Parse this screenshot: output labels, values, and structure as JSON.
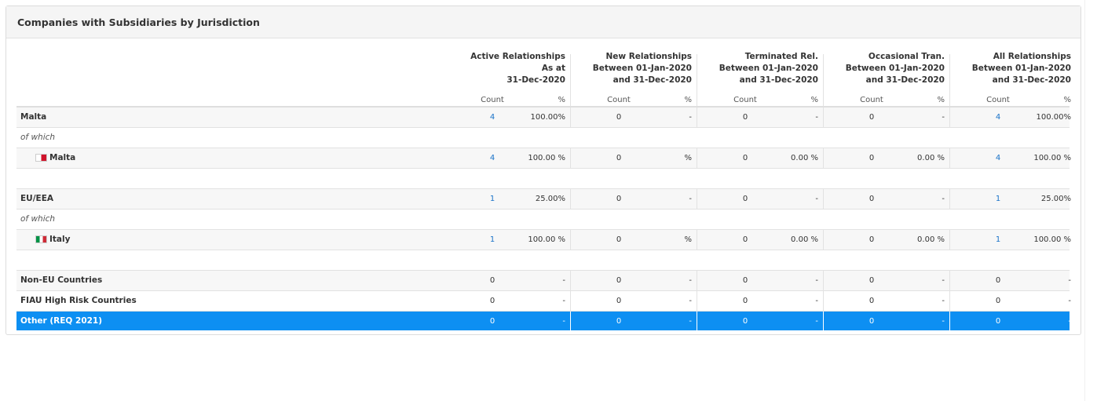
{
  "panel": {
    "title": "Companies with Subsidiaries by Jurisdiction"
  },
  "columns": [
    {
      "title_lines": [
        "Active Relationships",
        "As at",
        "31-Dec-2020"
      ],
      "count_label": "Count",
      "pct_label": "%"
    },
    {
      "title_lines": [
        "New Relationships",
        "Between 01-Jan-2020",
        "and 31-Dec-2020"
      ],
      "count_label": "Count",
      "pct_label": "%"
    },
    {
      "title_lines": [
        "Terminated Rel.",
        "Between 01-Jan-2020",
        "and 31-Dec-2020"
      ],
      "count_label": "Count",
      "pct_label": "%"
    },
    {
      "title_lines": [
        "Occasional Tran.",
        "Between 01-Jan-2020",
        "and 31-Dec-2020"
      ],
      "count_label": "Count",
      "pct_label": "%"
    },
    {
      "title_lines": [
        "All Relationships",
        "Between 01-Jan-2020",
        "and 31-Dec-2020"
      ],
      "count_label": "Count",
      "pct_label": "%"
    }
  ],
  "rows": [
    {
      "kind": "group",
      "label": "Malta",
      "cells": [
        [
          "4",
          "100.00%"
        ],
        [
          "0",
          "-"
        ],
        [
          "0",
          "-"
        ],
        [
          "0",
          "-"
        ],
        [
          "4",
          "100.00%"
        ]
      ],
      "links": [
        true,
        false,
        false,
        false,
        true
      ]
    },
    {
      "kind": "note",
      "label": "of which"
    },
    {
      "kind": "country",
      "label": "Malta",
      "flag": "malta-flag-icon",
      "cells": [
        [
          "4",
          "100.00 %"
        ],
        [
          "0",
          "%"
        ],
        [
          "0",
          "0.00 %"
        ],
        [
          "0",
          "0.00 %"
        ],
        [
          "4",
          "100.00 %"
        ]
      ],
      "links": [
        true,
        false,
        false,
        false,
        true
      ]
    },
    {
      "kind": "blank"
    },
    {
      "kind": "group",
      "label": "EU/EEA",
      "cells": [
        [
          "1",
          "25.00%"
        ],
        [
          "0",
          "-"
        ],
        [
          "0",
          "-"
        ],
        [
          "0",
          "-"
        ],
        [
          "1",
          "25.00%"
        ]
      ],
      "links": [
        true,
        false,
        false,
        false,
        true
      ]
    },
    {
      "kind": "note",
      "label": "of which"
    },
    {
      "kind": "country",
      "label": "Italy",
      "flag": "italy-flag-icon",
      "cells": [
        [
          "1",
          "100.00 %"
        ],
        [
          "0",
          "%"
        ],
        [
          "0",
          "0.00 %"
        ],
        [
          "0",
          "0.00 %"
        ],
        [
          "1",
          "100.00 %"
        ]
      ],
      "links": [
        true,
        false,
        false,
        false,
        true
      ]
    },
    {
      "kind": "blank"
    },
    {
      "kind": "group",
      "label": "Non-EU Countries",
      "cells": [
        [
          "0",
          "-"
        ],
        [
          "0",
          "-"
        ],
        [
          "0",
          "-"
        ],
        [
          "0",
          "-"
        ],
        [
          "0",
          "-"
        ]
      ],
      "links": [
        false,
        false,
        false,
        false,
        false
      ]
    },
    {
      "kind": "plain",
      "label": "FIAU High Risk Countries",
      "cells": [
        [
          "0",
          "-"
        ],
        [
          "0",
          "-"
        ],
        [
          "0",
          "-"
        ],
        [
          "0",
          "-"
        ],
        [
          "0",
          "-"
        ]
      ],
      "links": [
        false,
        false,
        false,
        false,
        false
      ]
    },
    {
      "kind": "selected",
      "label": "Other (REQ 2021)",
      "cells": [
        [
          "0",
          "-"
        ],
        [
          "0",
          "-"
        ],
        [
          "0",
          "-"
        ],
        [
          "0",
          "-"
        ],
        [
          "0",
          "-"
        ]
      ],
      "links": [
        false,
        false,
        false,
        false,
        false
      ]
    }
  ]
}
